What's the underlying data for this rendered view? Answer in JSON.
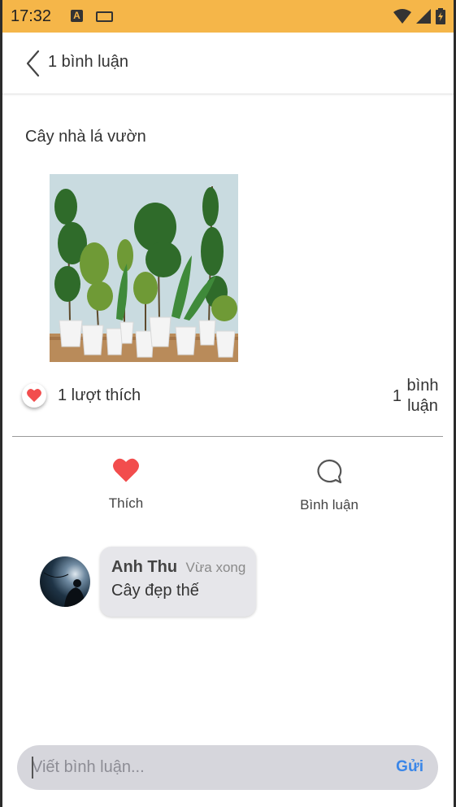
{
  "status_bar": {
    "time": "17:32",
    "icons": [
      "a-notification-icon",
      "keyboard-icon",
      "wifi-icon",
      "cell-signal-icon",
      "battery-icon"
    ],
    "background": "#f5b649"
  },
  "header": {
    "title": "1 bình luận",
    "back_icon": "chevron-left-icon"
  },
  "post": {
    "text": "Cây nhà lá vườn",
    "image_description_icon": "potted-plants-photo",
    "likes_label": "1 lượt thích",
    "comments_count": "1",
    "comments_word_line1": "bình",
    "comments_word_line2": "luận"
  },
  "actions": {
    "like_label": "Thích",
    "comment_label": "Bình luận",
    "like_color": "#f24d4d"
  },
  "comments": [
    {
      "author": "Anh Thu",
      "time": "Vừa xong",
      "text": "Cây đẹp thế"
    }
  ],
  "composer": {
    "placeholder": "Viết bình luận...",
    "send_label": "Gửi",
    "accent": "#3a86e8"
  }
}
